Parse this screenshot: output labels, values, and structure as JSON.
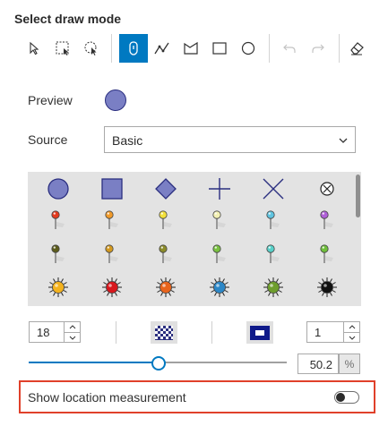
{
  "header": {
    "title": "Select draw mode"
  },
  "toolbar": {
    "tools": [
      {
        "name": "select-arrow-icon",
        "active": false
      },
      {
        "name": "rectangle-select-icon",
        "active": false
      },
      {
        "name": "lasso-select-icon",
        "active": false
      },
      {
        "name": "point-pin-icon",
        "active": true
      },
      {
        "name": "polyline-icon",
        "active": false
      },
      {
        "name": "polygon-icon",
        "active": false
      },
      {
        "name": "rectangle-icon",
        "active": false
      },
      {
        "name": "circle-icon",
        "active": false
      },
      {
        "name": "undo-icon",
        "active": false
      },
      {
        "name": "redo-icon",
        "active": false
      },
      {
        "name": "eraser-icon",
        "active": false
      }
    ]
  },
  "preview": {
    "label": "Preview",
    "color": "#7a7fc4"
  },
  "source": {
    "label": "Source",
    "value": "Basic"
  },
  "gallery": {
    "row1": [
      "circle",
      "square",
      "diamond",
      "cross",
      "x",
      "circle-x"
    ],
    "pin_colors": [
      "#e53b1f",
      "#f19b2a",
      "#f3e13c",
      "#f2f0b4",
      "#5fc4e0",
      "#b060d8"
    ],
    "pin_colors_row3": [
      "#5c5c1c",
      "#d49a20",
      "#8c8c2a",
      "#79c141",
      "#58d1c9",
      "#6fbf3b"
    ],
    "sun_colors": [
      "#f3b21e",
      "#d8171d",
      "#e8641c",
      "#2c87c7",
      "#6e9e2d",
      "#111111"
    ]
  },
  "controls": {
    "size_value": "18",
    "outline_width_value": "1",
    "transparency_value": 50.2,
    "transparency_text": "50.2",
    "unit": "%"
  },
  "location": {
    "label": "Show location measurement",
    "enabled": false
  }
}
